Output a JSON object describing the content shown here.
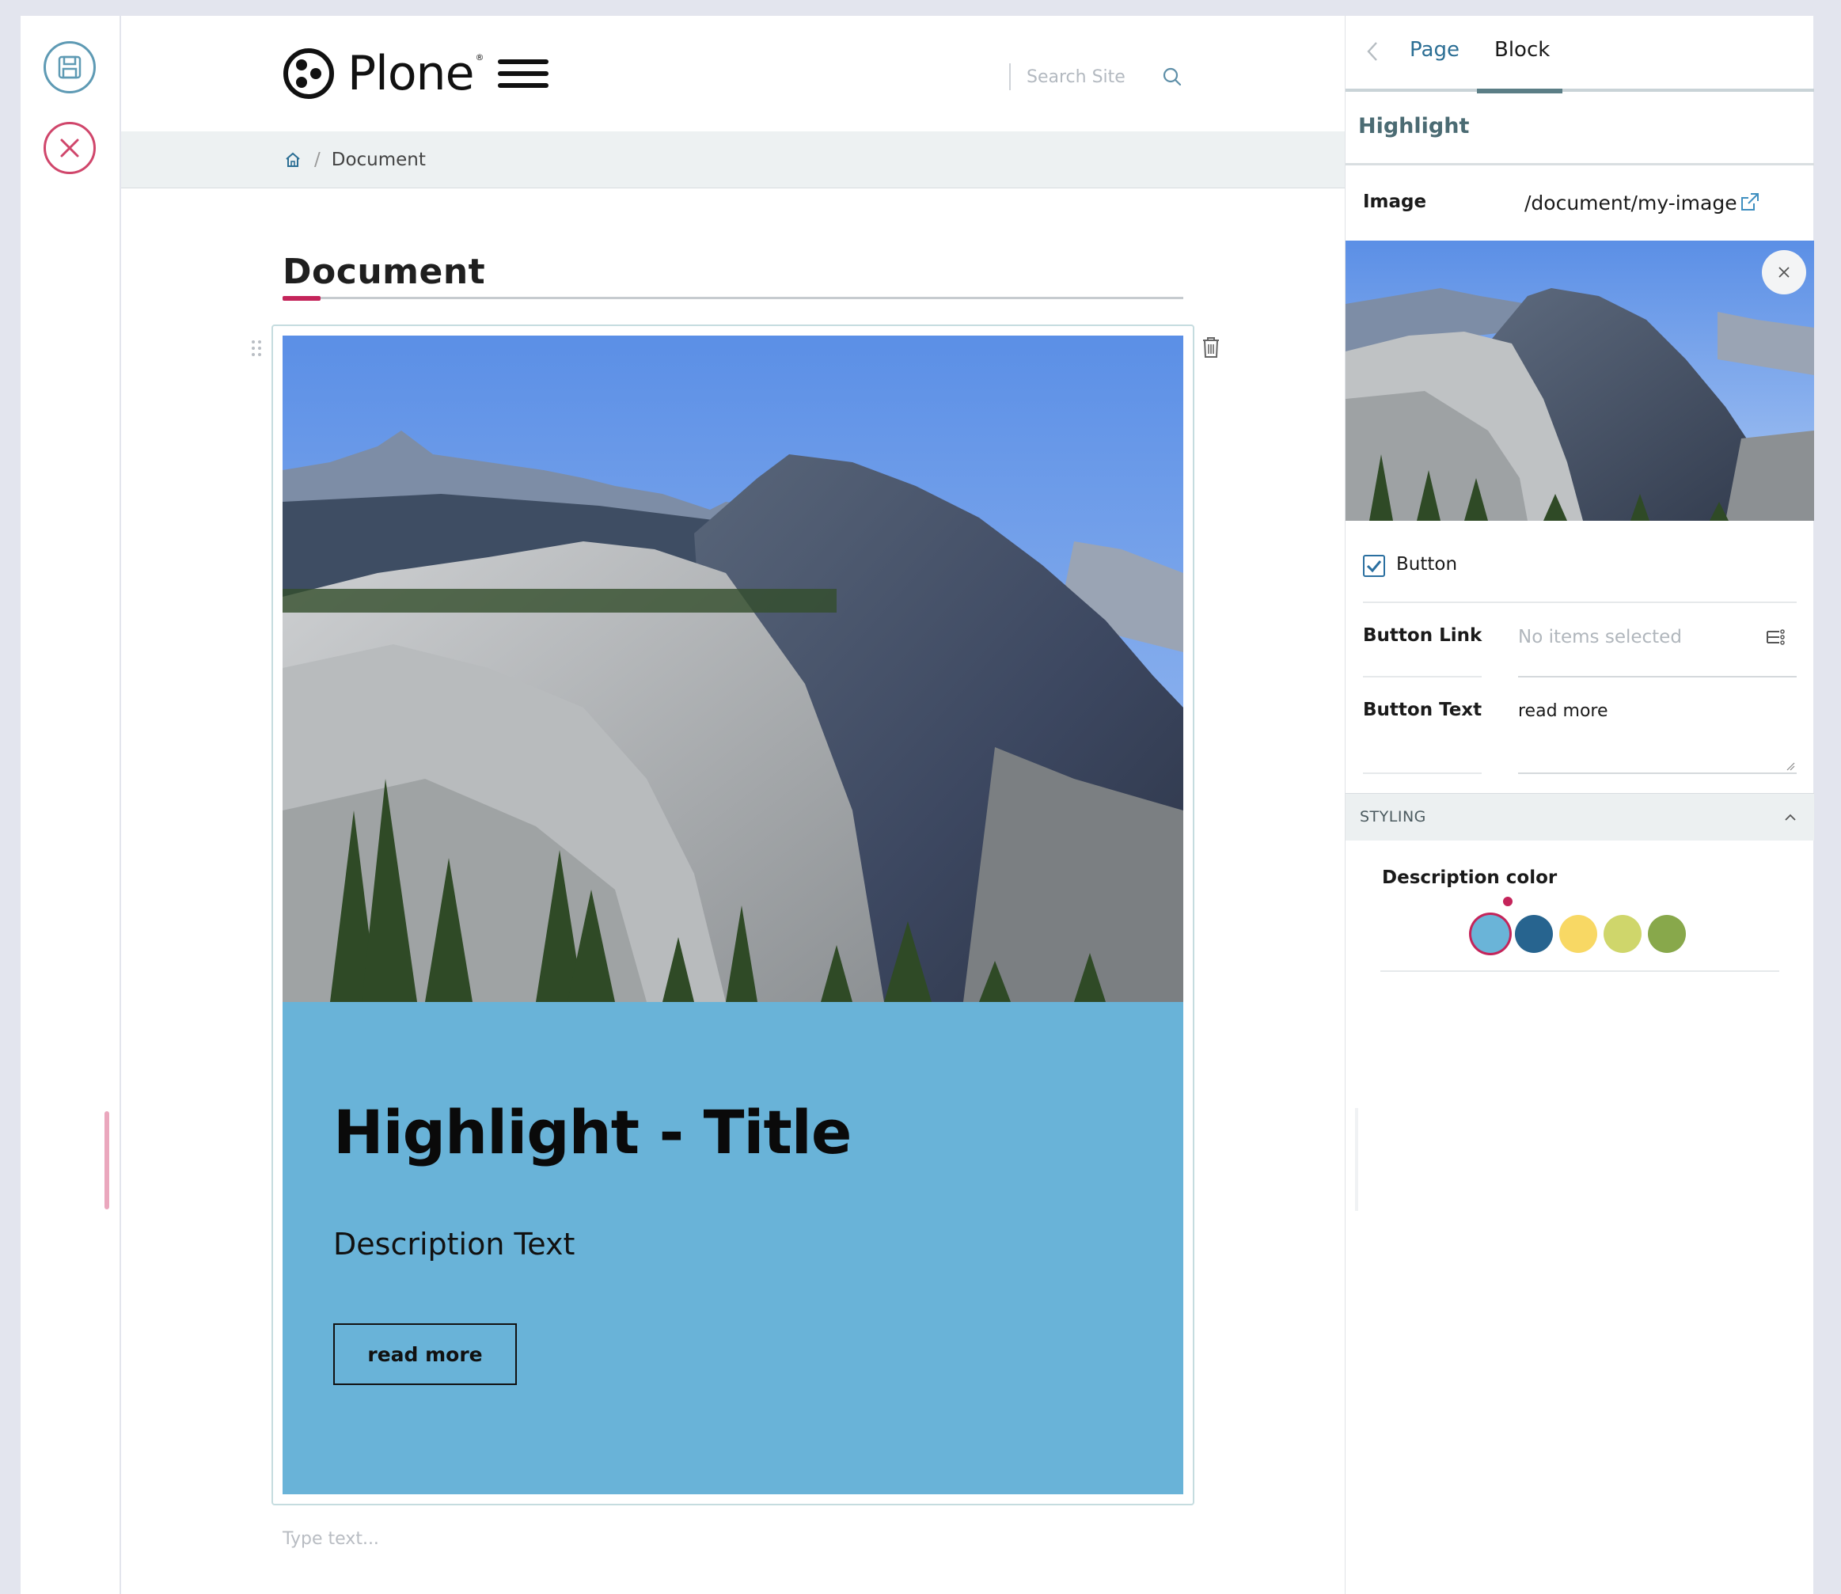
{
  "toolbar": {
    "save_icon": "save-icon",
    "cancel_icon": "close-circle-icon"
  },
  "header": {
    "logo_text": "Plone",
    "logo_reg": "®",
    "search_placeholder": "Search Site"
  },
  "breadcrumb": {
    "home_icon": "home-icon",
    "separator": "/",
    "current": "Document"
  },
  "document": {
    "title": "Document",
    "highlight": {
      "title": "Highlight - Title",
      "description": "Description Text",
      "button_label": "read more",
      "panel_color": "#69b3d8"
    },
    "type_text_placeholder": "Type text..."
  },
  "sidebar": {
    "tabs": [
      {
        "label": "Page",
        "active": false
      },
      {
        "label": "Block",
        "active": true
      }
    ],
    "section_title": "Highlight",
    "image_label": "Image",
    "image_path": "/document/my-image",
    "button_checkbox_label": "Button",
    "button_checked": true,
    "button_link_label": "Button Link",
    "button_link_placeholder": "No items selected",
    "button_text_label": "Button Text",
    "button_text_value": "read more",
    "styling_label": "STYLING",
    "description_color_label": "Description color",
    "colors": [
      "#6ab4d8",
      "#27648f",
      "#f8d864",
      "#cfd66b",
      "#88a84b"
    ],
    "selected_color": "#6ab4d8"
  },
  "colors": {
    "accent": "#c4245a",
    "link": "#2b6e94"
  }
}
